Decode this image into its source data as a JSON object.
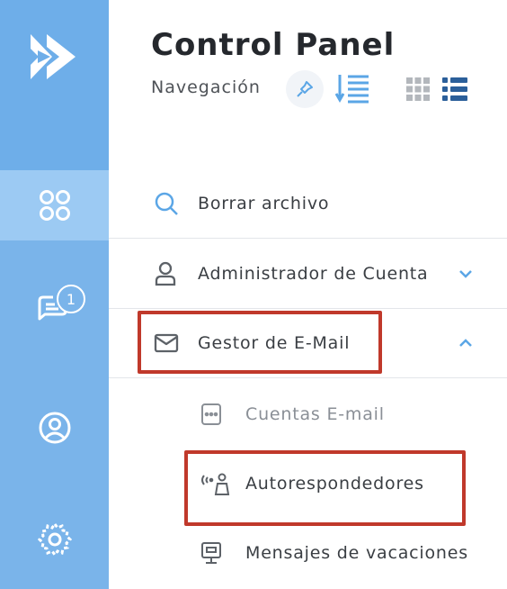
{
  "header": {
    "title": "Control Panel",
    "subtitle": "Navegación"
  },
  "rail": {
    "items": [
      {
        "icon": "apps-grid-icon",
        "active": true
      },
      {
        "icon": "chat-icon",
        "badge": "1"
      },
      {
        "icon": "user-circle-icon"
      },
      {
        "icon": "gear-icon"
      }
    ]
  },
  "menu": {
    "items": [
      {
        "label": "Borrar archivo",
        "icon": "search-icon"
      },
      {
        "label": "Administrador de Cuenta",
        "icon": "user-icon",
        "expanded": false
      },
      {
        "label": "Gestor de E-Mail",
        "icon": "envelope-icon",
        "expanded": true,
        "children": [
          {
            "label": "Cuentas E-mail",
            "icon": "email-accounts-icon"
          },
          {
            "label": "Autorespondedores",
            "icon": "autoresponder-icon"
          },
          {
            "label": "Mensajes de vacaciones",
            "icon": "vacation-message-icon"
          }
        ]
      }
    ]
  },
  "colors": {
    "rail": "#7ab4ea",
    "rail_active": "#9ccaf3",
    "accent": "#5ba6e6",
    "highlight": "#c0392b"
  }
}
